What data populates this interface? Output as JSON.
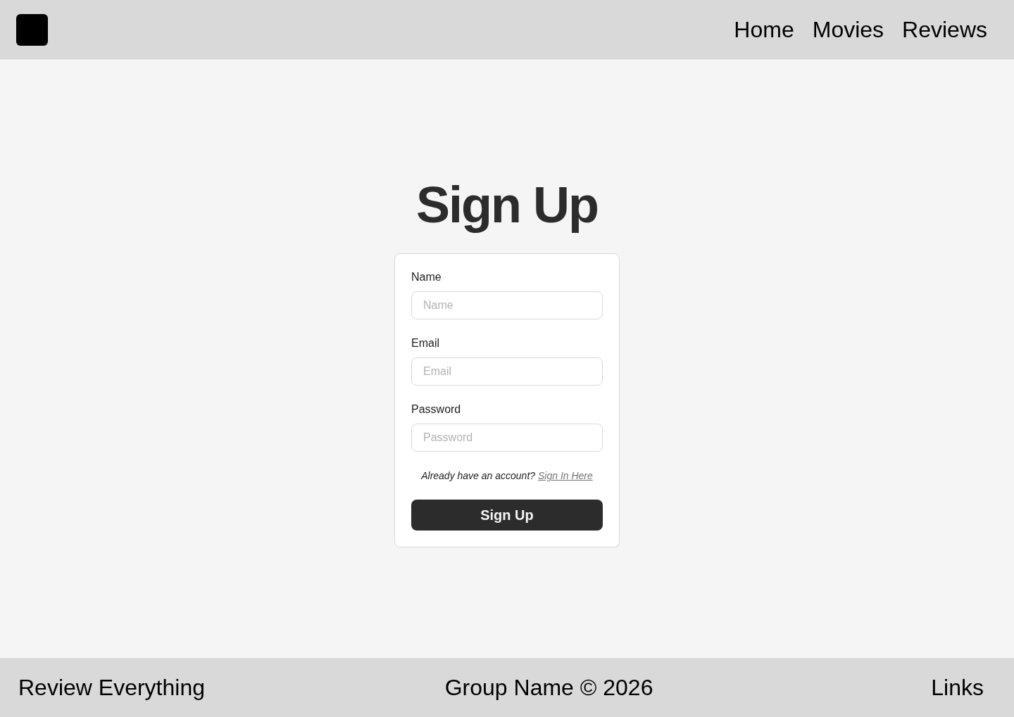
{
  "header": {
    "nav_links": [
      "Home",
      "Movies",
      "Reviews"
    ]
  },
  "title": "Sign Up",
  "form": {
    "fields": [
      {
        "label": "Name",
        "placeholder": "Name"
      },
      {
        "label": "Email",
        "placeholder": "Email"
      },
      {
        "label": "Password",
        "placeholder": "Password"
      }
    ],
    "prompt": "Already have an account?",
    "link": "Sign In Here",
    "submit": "Sign Up"
  },
  "footer": {
    "tagline": "Review Everything",
    "copyright": "Group Name © 2026",
    "links": "Links"
  }
}
